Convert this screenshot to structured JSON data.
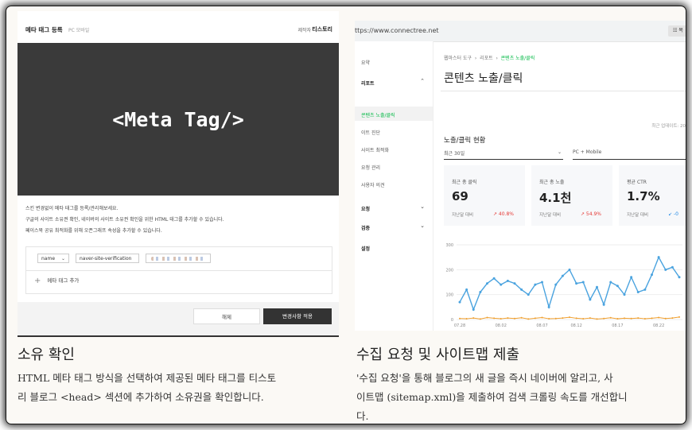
{
  "left": {
    "header": {
      "title": "메타 태그 등록",
      "sub": "PC 모바일",
      "author_label": "제작자",
      "author": "티스토리"
    },
    "banner": "<Meta Tag/>",
    "desc": [
      "스킨 변경없이 메타 태그를 등록/관리해보세요.",
      "구글의 사이트 소유권 확인, 네이버의 사이트 소유권 확인을 위한 HTML 태그를 추가할 수 있습니다.",
      "페이스북 공유 최적화를 위해 오픈그래프 속성을 추가할 수 있습니다."
    ],
    "form": {
      "select_value": "name",
      "content_value": "naver-site-verification",
      "add_label": "메타 태그 추가"
    },
    "buttons": {
      "cancel": "해제",
      "save": "변경사항 적용"
    },
    "caption": {
      "title": "소유 확인",
      "desc_line1": "HTML 메타 태그 방식을 선택하여 제공된 메타 태그를 티스토",
      "desc_line2": "리 블로그 <head> 섹션에 추가하여 소유권을 확인합니다."
    }
  },
  "right": {
    "url": "ttps://www.connectree.net",
    "url_button": "☷ 목",
    "sidebar": [
      "요약",
      "리포트",
      "콘텐츠 노출/클릭",
      "이트 진단",
      "사이트 최적화",
      "요청 관리",
      "사용자 의견",
      "요청",
      "검증",
      "설정"
    ],
    "breadcrumb": {
      "a": "웹마스터 도구",
      "b": "리포트",
      "c": "콘텐츠 노출/클릭"
    },
    "page_title": "콘텐츠 노출/클릭",
    "updated": "최근 업데이트: 20",
    "section_title": "노출/클릭 현황",
    "period": "최근 30일",
    "device": "PC + Mobile",
    "cards": [
      {
        "label": "최근 총 클릭",
        "value": "69",
        "sub": "지난달 대비",
        "delta": "↗ 40.8%"
      },
      {
        "label": "최근 총 노출",
        "value": "4.1천",
        "sub": "지난달 대비",
        "delta": "↗ 54.9%"
      },
      {
        "label": "평균 CTR",
        "value": "1.7%",
        "sub": "지난달 대비",
        "delta": "↙ -0"
      }
    ],
    "caption": {
      "title": "수집 요청 및 사이트맵 제출",
      "desc_line1": "'수집 요청'을 통해 블로그의 새 글을 즉시 네이버에 알리고, 사",
      "desc_line2": "이트맵 (sitemap.xml)을 제출하여 검색 크롤링 속도를 개선합니",
      "desc_line3": "다."
    }
  },
  "colors": {
    "accent_green": "#00b843",
    "line_blue": "#4aa3df",
    "line_orange": "#f0a030",
    "delta_red": "#e53935",
    "delta_blue": "#1e88e5"
  },
  "chart_data": {
    "type": "line",
    "x": [
      "07.28",
      "08.02",
      "08.07",
      "08.12",
      "08.17",
      "08.22"
    ],
    "ylim": [
      0,
      300
    ],
    "yticks": [
      0,
      100,
      200,
      300
    ],
    "series": [
      {
        "values": [
          70,
          120,
          40,
          110,
          145,
          165,
          140,
          155,
          145,
          120,
          100,
          140,
          150,
          50,
          140,
          175,
          200,
          145,
          150,
          80,
          130,
          60,
          150,
          135,
          100,
          170,
          110,
          120,
          180,
          250,
          200,
          210,
          170
        ]
      },
      {
        "values": [
          4,
          3,
          6,
          2,
          8,
          5,
          3,
          6,
          4,
          7,
          2,
          5,
          8,
          3,
          4,
          6,
          9,
          5,
          3,
          6,
          2,
          4,
          7,
          3,
          5,
          4,
          6,
          3,
          5,
          8,
          4,
          6,
          10
        ]
      }
    ]
  }
}
